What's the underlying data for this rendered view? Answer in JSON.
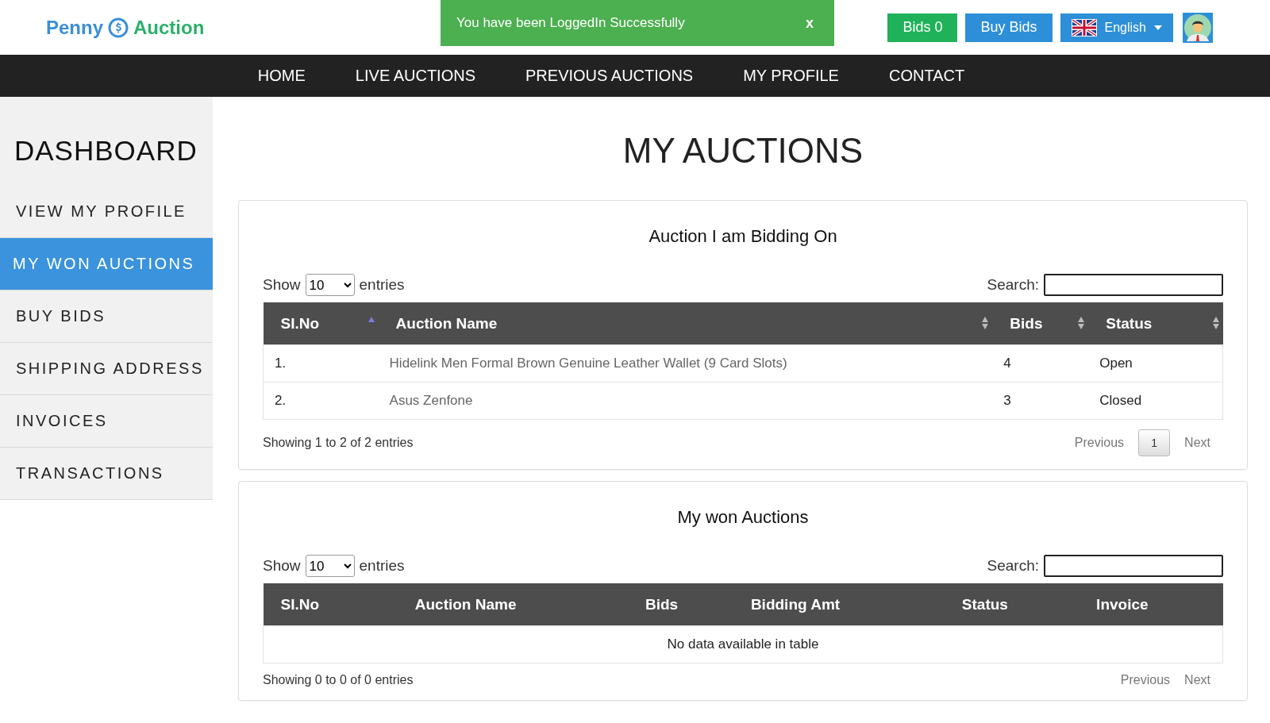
{
  "header": {
    "logo_left": "Penny",
    "logo_right": "Auction",
    "alert": {
      "message": "You have been LoggedIn Successfully",
      "close": "x"
    },
    "bids_button": "Bids 0",
    "buy_button": "Buy Bids",
    "language": "English"
  },
  "nav": [
    "HOME",
    "LIVE AUCTIONS",
    "PREVIOUS AUCTIONS",
    "MY PROFILE",
    "CONTACT"
  ],
  "sidebar": {
    "title": "DASHBOARD",
    "items": [
      {
        "label": "VIEW MY PROFILE",
        "selected": false
      },
      {
        "label": "MY WON AUCTIONS",
        "selected": true
      },
      {
        "label": "BUY BIDS",
        "selected": false
      },
      {
        "label": "SHIPPING ADDRESS",
        "selected": false
      },
      {
        "label": "INVOICES",
        "selected": false
      },
      {
        "label": "TRANSACTIONS",
        "selected": false
      }
    ]
  },
  "page_title": "MY AUCTIONS",
  "panels": [
    {
      "title": "Auction I am Bidding On",
      "show_label": "Show",
      "length": "10",
      "entries_label": "entries",
      "search_label": "Search:",
      "columns": [
        {
          "label": "SI.No",
          "sortable": true,
          "sorted_ascending": true
        },
        {
          "label": "Auction Name",
          "sortable": true,
          "sorted_ascending": false,
          "muted": true
        },
        {
          "label": "Bids",
          "sortable": true,
          "sorted_ascending": false
        },
        {
          "label": "Status",
          "sortable": true,
          "sorted_ascending": false
        }
      ],
      "rows": [
        [
          "1.",
          "Hidelink Men Formal Brown Genuine Leather Wallet (9 Card Slots)",
          "4",
          "Open"
        ],
        [
          "2.",
          "Asus Zenfone",
          "3",
          "Closed"
        ]
      ],
      "info": "Showing 1 to 2 of 2 entries",
      "pagination": {
        "previous": "Previous",
        "pages": [
          {
            "label": "1",
            "selected": true
          }
        ],
        "next": "Next"
      }
    },
    {
      "title": "My won Auctions",
      "show_label": "Show",
      "length": "10",
      "entries_label": "entries",
      "search_label": "Search:",
      "columns": [
        {
          "label": "SI.No",
          "sortable": false
        },
        {
          "label": "Auction Name",
          "sortable": false
        },
        {
          "label": "Bids",
          "sortable": false
        },
        {
          "label": "Bidding Amt",
          "sortable": false
        },
        {
          "label": "Status",
          "sortable": false
        },
        {
          "label": "Invoice",
          "sortable": false
        }
      ],
      "empty_message": "No data available in table",
      "info": "Showing 0 to 0 of 0 entries",
      "pagination": {
        "previous": "Previous",
        "next": "Next"
      }
    }
  ]
}
